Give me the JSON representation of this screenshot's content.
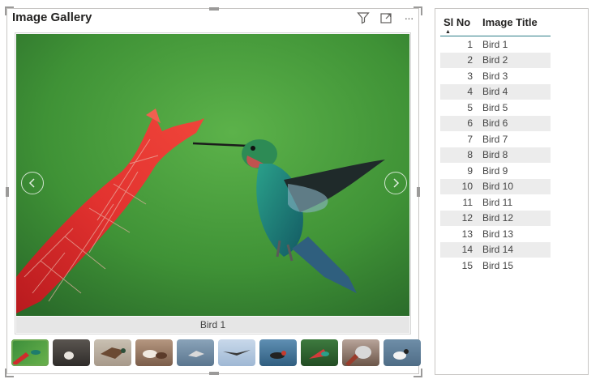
{
  "gallery": {
    "title": "Image Gallery",
    "caption": "Bird 1",
    "header_icons": [
      "filter-icon",
      "focus-mode-icon",
      "more-options-icon"
    ],
    "more_label": "···",
    "thumbnail_count": 10,
    "active_thumbnail": 1
  },
  "table": {
    "columns": [
      "Sl No",
      "Image Title"
    ],
    "sort_column": "Sl No",
    "sort_direction": "ascending",
    "rows": [
      {
        "sl": "1",
        "title": "Bird 1"
      },
      {
        "sl": "2",
        "title": "Bird 2"
      },
      {
        "sl": "3",
        "title": "Bird 3"
      },
      {
        "sl": "4",
        "title": "Bird 4"
      },
      {
        "sl": "5",
        "title": "Bird 5"
      },
      {
        "sl": "6",
        "title": "Bird 6"
      },
      {
        "sl": "7",
        "title": "Bird 7"
      },
      {
        "sl": "8",
        "title": "Bird 8"
      },
      {
        "sl": "9",
        "title": "Bird 9"
      },
      {
        "sl": "10",
        "title": "Bird 10"
      },
      {
        "sl": "11",
        "title": "Bird 11"
      },
      {
        "sl": "12",
        "title": "Bird 12"
      },
      {
        "sl": "13",
        "title": "Bird 13"
      },
      {
        "sl": "14",
        "title": "Bird 14"
      },
      {
        "sl": "15",
        "title": "Bird 15"
      }
    ]
  },
  "colors": {
    "photo_green": "#4f9c3f",
    "flower_red": "#d3262a",
    "bird_teal": "#1f8a6e",
    "header_rule": "#2c7c86",
    "row_alt": "#ececec"
  }
}
